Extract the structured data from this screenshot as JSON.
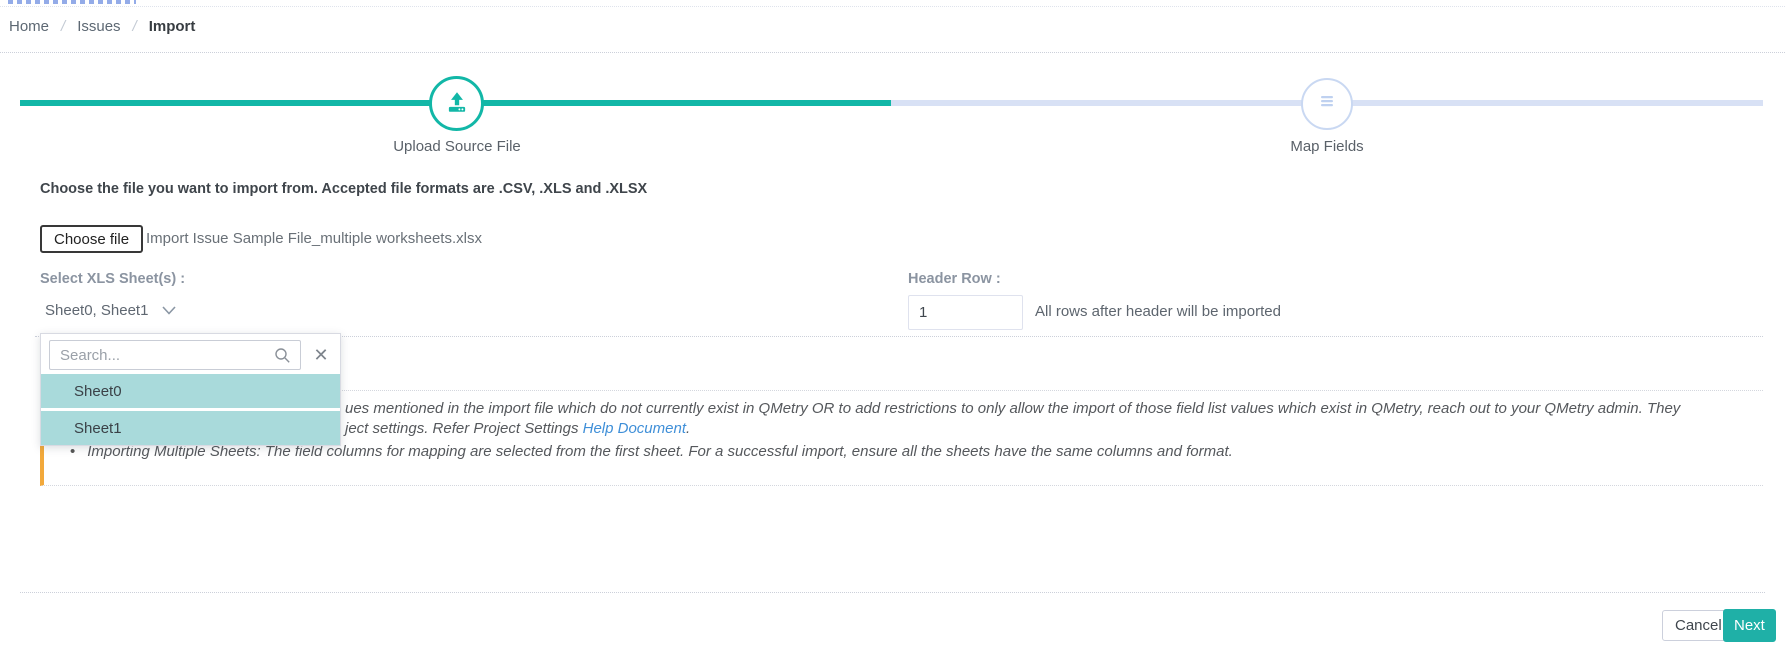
{
  "breadcrumb": {
    "home": "Home",
    "issues": "Issues",
    "current": "Import",
    "separator": "/"
  },
  "stepper": {
    "steps": [
      {
        "label": "Upload Source File",
        "state": "active",
        "icon": "upload-icon"
      },
      {
        "label": "Map Fields",
        "state": "inactive",
        "icon": "list-icon"
      }
    ]
  },
  "upload_section": {
    "instruction": "Choose the file you want to import from. Accepted file formats are .CSV, .XLS and .XLSX",
    "choose_file_label": "Choose file",
    "file_name": "Import Issue Sample File_multiple worksheets.xlsx"
  },
  "sheet_select": {
    "label": "Select XLS Sheet(s) :",
    "value": "Sheet0, Sheet1",
    "dropdown": {
      "search_placeholder": "Search...",
      "options": [
        {
          "label": "Sheet0",
          "selected": true
        },
        {
          "label": "Sheet1",
          "selected": true
        }
      ]
    }
  },
  "header_row": {
    "label": "Header Row :",
    "value": "1",
    "hint": "All rows after header will be imported"
  },
  "note": {
    "bullet1_line1": "ues mentioned in the import file which do not currently exist in QMetry OR to add restrictions to only allow the import of those field list values which exist in QMetry, reach out to your QMetry admin. They",
    "bullet1_line2_prefix": "ject settings. Refer Project Settings ",
    "bullet1_link": "Help Document",
    "bullet1_suffix": ".",
    "bullet_marker": "•",
    "bullet2": "Importing Multiple Sheets: The field columns for mapping are selected from the first sheet. For a successful import, ensure all the sheets have the same columns and format."
  },
  "footer": {
    "cancel_label": "Cancel",
    "next_label": "Next"
  },
  "colors": {
    "accent_teal": "#12b7a7",
    "next_button_teal": "#1fb0a7",
    "inactive_step_blue": "#d8e1f5",
    "note_border_orange": "#f2a93b",
    "link_blue": "#3f8fd8",
    "option_selected_bg": "#a9dadb"
  }
}
